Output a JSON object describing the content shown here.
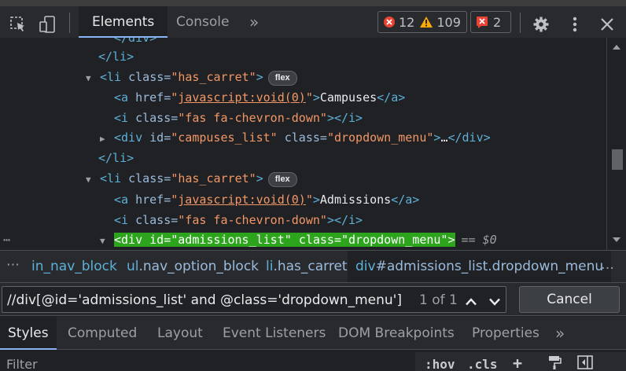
{
  "toolbar": {
    "tabs": [
      "Elements",
      "Console"
    ],
    "more_tabs": "»",
    "errors_count": "12",
    "warnings_count": "109",
    "issues_count": "2"
  },
  "dom_tree": {
    "line0": {
      "close_tag": "</div>"
    },
    "line1": {
      "close_tag": "</li>"
    },
    "line2": {
      "open": "<li",
      "attr": "class=",
      "val": "\"has_carret\"",
      "close": ">",
      "badge": "flex"
    },
    "line3": {
      "open": "<a",
      "attr": "href=",
      "q1": "\"",
      "link": "javascript:void(0)",
      "q2": "\"",
      "close": ">",
      "text": "Campuses",
      "end": "</a>"
    },
    "line4": {
      "open": "<i",
      "attr": "class=",
      "val": "\"fas fa-chevron-down\"",
      "end": "></i>"
    },
    "line5": {
      "open": "<div",
      "attr1": "id=",
      "val1": "\"campuses_list\"",
      "attr2": "class=",
      "val2": "\"dropdown_menu\"",
      "close": ">",
      "ellipsis": "…",
      "end": "</div>"
    },
    "line6": {
      "close_tag": "</li>"
    },
    "line7": {
      "open": "<li",
      "attr": "class=",
      "val": "\"has_carret\"",
      "close": ">",
      "badge": "flex"
    },
    "line8": {
      "open": "<a",
      "attr": "href=",
      "q1": "\"",
      "link": "javascript:void(0)",
      "q2": "\"",
      "close": ">",
      "text": "Admissions",
      "end": "</a>"
    },
    "line9": {
      "open": "<i",
      "attr": "class=",
      "val": "\"fas fa-chevron-down\"",
      "end": "></i>"
    },
    "selected": {
      "open": "<div",
      "attr1": "id=",
      "val1": "\"admissions_list\"",
      "attr2": "class=",
      "val2": "\"dropdown_menu\"",
      "close": ">",
      "eq": "== $0"
    }
  },
  "breadcrumbs": {
    "items": [
      {
        "el": "in_nav_block",
        "cls": ""
      },
      {
        "el": "ul",
        "cls": ".nav_option_block"
      },
      {
        "el": "li",
        "cls": ".has_carret"
      },
      {
        "el": "div",
        "cls": "#admissions_list.dropdown_menu"
      }
    ],
    "more": "…"
  },
  "search": {
    "value": "//div[@id='admissions_list' and @class='dropdown_menu']",
    "count": "1 of 1",
    "cancel_label": "Cancel"
  },
  "panel_tabs": [
    "Styles",
    "Computed",
    "Layout",
    "Event Listeners",
    "DOM Breakpoints",
    "Properties"
  ],
  "panel_more": "»",
  "filter": {
    "placeholder": "Filter",
    "hov": ":hov",
    "cls": ".cls",
    "plus": "+"
  },
  "colors": {
    "accent": "#8ab4f8",
    "error": "#e94335",
    "warning": "#f9ab00",
    "selected_bg": "#2ca51d"
  }
}
